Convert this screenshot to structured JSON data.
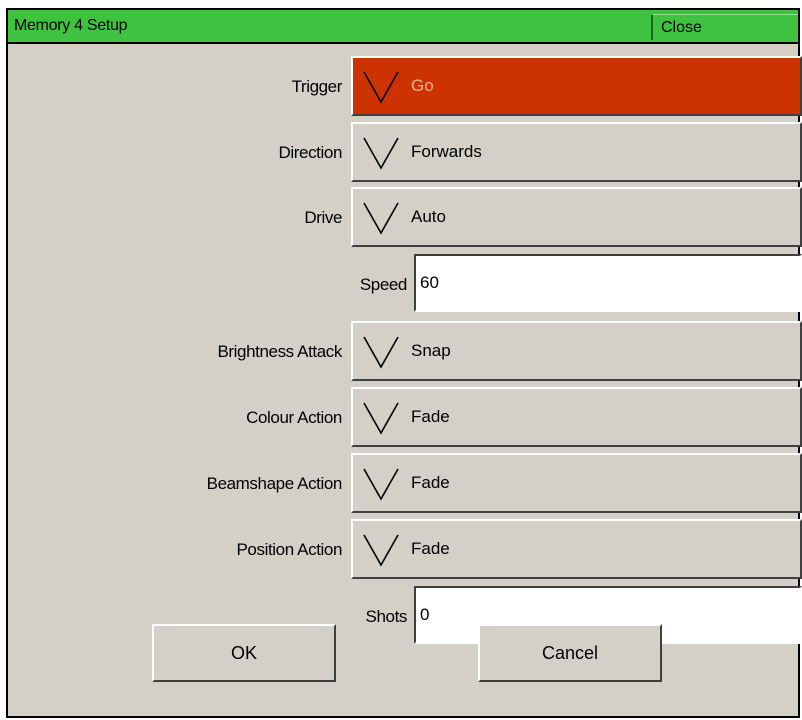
{
  "window": {
    "title": "Memory 4 Setup",
    "close_label": "Close"
  },
  "fields": {
    "trigger": {
      "label": "Trigger",
      "value": "Go"
    },
    "direction": {
      "label": "Direction",
      "value": "Forwards"
    },
    "drive": {
      "label": "Drive",
      "value": "Auto"
    },
    "speed": {
      "label": "Speed",
      "value": "60"
    },
    "brightness_attack": {
      "label": "Brightness Attack",
      "value": "Snap"
    },
    "colour_action": {
      "label": "Colour Action",
      "value": "Fade"
    },
    "beamshape_action": {
      "label": "Beamshape Action",
      "value": "Fade"
    },
    "position_action": {
      "label": "Position Action",
      "value": "Fade"
    },
    "shots": {
      "label": "Shots",
      "value": "0"
    }
  },
  "buttons": {
    "ok_label": "OK",
    "cancel_label": "Cancel"
  },
  "colors": {
    "titlebar": "#3fc23f",
    "trigger_active": "#cc3300",
    "panel": "#d4d0c8"
  },
  "icons": {
    "dropdown": "chevron-down-icon"
  }
}
